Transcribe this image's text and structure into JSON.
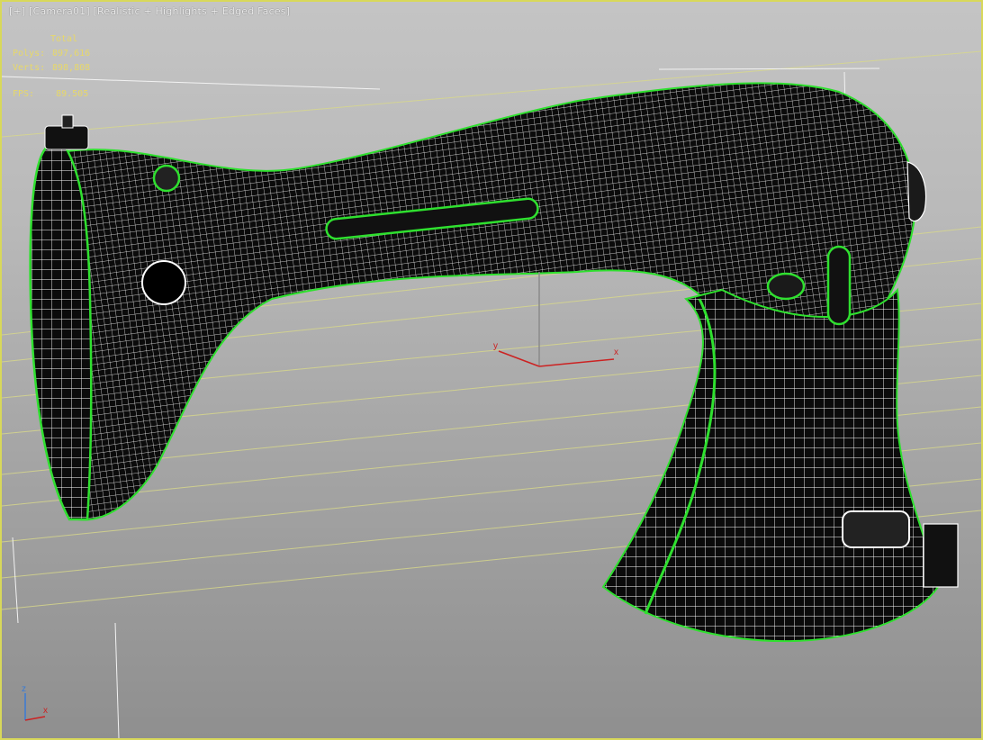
{
  "viewport": {
    "label": "[+] [Camera01] [Realistic + Highlights + Edged Faces]",
    "stats": {
      "header": "Total",
      "rows": [
        {
          "key": "Polys:",
          "value": "897,616"
        },
        {
          "key": "Verts:",
          "value": "898,808"
        }
      ],
      "fps_key": "FPS:",
      "fps_value": "89.505"
    }
  },
  "gizmo": {
    "x_label": "x",
    "y_label": "y"
  },
  "world_axis": {
    "x_label": "x",
    "z_label": "z"
  },
  "colors": {
    "viewport_border": "#d8d85a",
    "selection_edge": "#2fe02f",
    "mesh_face": "#0b0b0b",
    "mesh_edge": "#ffffff",
    "gizmo_x": "#cc2222",
    "stats_text": "#e7d86a"
  },
  "scene": {
    "object": "sewing-machine-arm-mesh",
    "view_mode": "wireframe-on-shaded"
  }
}
